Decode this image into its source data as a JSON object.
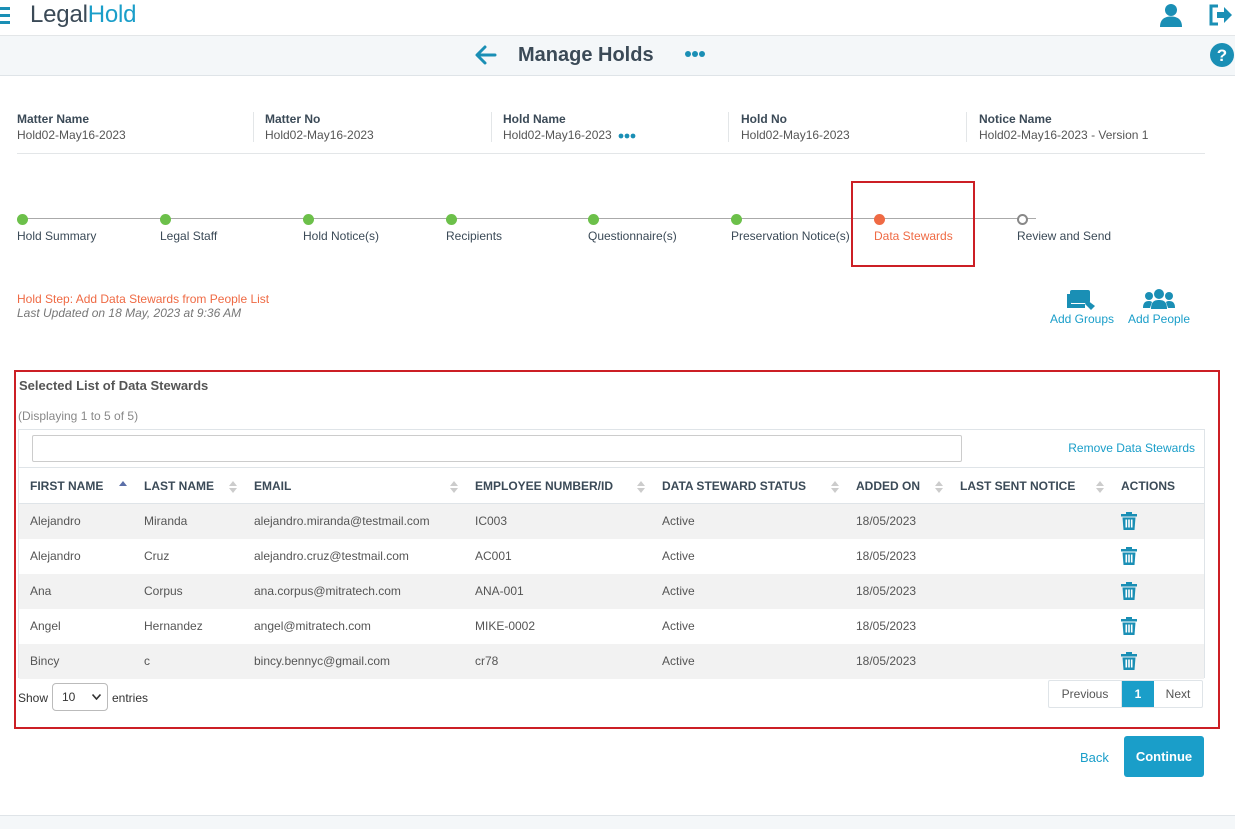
{
  "app": {
    "logo_part1": "Legal",
    "logo_part2": "Hold",
    "icons": [
      "menu-icon",
      "user-icon",
      "logout-icon",
      "back-arrow-icon",
      "more-icon",
      "help-icon"
    ]
  },
  "header": {
    "title": "Manage Holds"
  },
  "info": {
    "matter_name_label": "Matter Name",
    "matter_name_value": "Hold02-May16-2023",
    "matter_no_label": "Matter No",
    "matter_no_value": "Hold02-May16-2023",
    "hold_name_label": "Hold Name",
    "hold_name_value": "Hold02-May16-2023",
    "hold_no_label": "Hold No",
    "hold_no_value": "Hold02-May16-2023",
    "notice_name_label": "Notice Name",
    "notice_name_value": "Hold02-May16-2023 - Version 1"
  },
  "steps": [
    {
      "label": "Hold Summary",
      "status": "done"
    },
    {
      "label": "Legal Staff",
      "status": "done"
    },
    {
      "label": "Hold Notice(s)",
      "status": "done"
    },
    {
      "label": "Recipients",
      "status": "done"
    },
    {
      "label": "Questionnaire(s)",
      "status": "done"
    },
    {
      "label": "Preservation Notice(s)",
      "status": "done"
    },
    {
      "label": "Data Stewards",
      "status": "current"
    },
    {
      "label": "Review and Send",
      "status": "todo"
    }
  ],
  "status": {
    "hold_step": "Hold Step: Add Data Stewards from People List",
    "last_updated": "Last Updated on 18 May, 2023 at 9:36 AM"
  },
  "actions": {
    "add_groups": "Add Groups",
    "add_people": "Add People"
  },
  "panel": {
    "title": "Selected List of Data Stewards",
    "count": "(Displaying 1 to 5 of 5)",
    "remove_link": "Remove Data Stewards"
  },
  "table": {
    "columns": [
      "FIRST NAME",
      "LAST NAME",
      "EMAIL",
      "EMPLOYEE NUMBER/ID",
      "DATA STEWARD STATUS",
      "ADDED ON",
      "LAST SENT NOTICE",
      "ACTIONS"
    ],
    "rows": [
      {
        "first": "Alejandro",
        "last": "Miranda",
        "email": "alejandro.miranda@testmail.com",
        "emp": "IC003",
        "status": "Active",
        "added": "18/05/2023",
        "last_sent": ""
      },
      {
        "first": "Alejandro",
        "last": "Cruz",
        "email": "alejandro.cruz@testmail.com",
        "emp": "AC001",
        "status": "Active",
        "added": "18/05/2023",
        "last_sent": ""
      },
      {
        "first": "Ana",
        "last": "Corpus",
        "email": "ana.corpus@mitratech.com",
        "emp": "ANA-001",
        "status": "Active",
        "added": "18/05/2023",
        "last_sent": ""
      },
      {
        "first": "Angel",
        "last": "Hernandez",
        "email": "angel@mitratech.com",
        "emp": "MIKE-0002",
        "status": "Active",
        "added": "18/05/2023",
        "last_sent": ""
      },
      {
        "first": "Bincy",
        "last": "c",
        "email": "bincy.bennyc@gmail.com",
        "emp": "cr78",
        "status": "Active",
        "added": "18/05/2023",
        "last_sent": ""
      }
    ]
  },
  "pagination": {
    "show_label": "Show",
    "entries_value": "10",
    "entries_label": "entries",
    "previous": "Previous",
    "current_page": "1",
    "next": "Next"
  },
  "footer_buttons": {
    "back": "Back",
    "continue": "Continue"
  },
  "colors": {
    "accent": "#1a9ec9",
    "done": "#6cc04a",
    "current": "#ef6a44",
    "highlight": "#cc1f25"
  }
}
